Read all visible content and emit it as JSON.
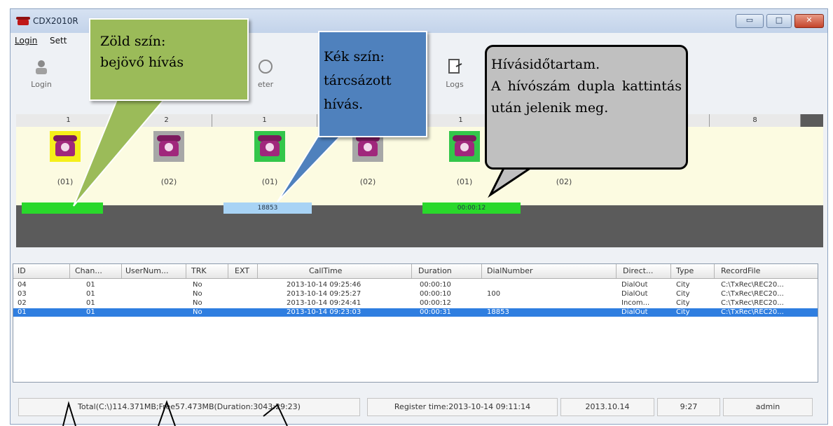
{
  "window": {
    "title": "CDX2010R",
    "controls": {
      "minimize": "▭",
      "maximize": "□",
      "close": "✕"
    }
  },
  "menu": [
    "Login",
    "Sett"
  ],
  "toolbar": {
    "buttons": [
      "Login",
      "eter",
      "Logs"
    ]
  },
  "channels": {
    "headers": [
      "1",
      "2",
      "1",
      "",
      "1",
      "",
      "",
      "",
      "8"
    ],
    "phones": [
      {
        "ext": "(01)",
        "bg_color": "#f5ef1a",
        "state": "incoming"
      },
      {
        "ext": "(02)",
        "bg_color": "#a7a7a7",
        "state": "idle"
      },
      {
        "ext": "(01)",
        "bg_color": "#33c64a",
        "state": "offhook"
      },
      {
        "ext": "(02)",
        "bg_color": "#a7a7a7",
        "state": "idle"
      },
      {
        "ext": "(01)",
        "bg_color": "#33c64a",
        "state": "offhook"
      },
      {
        "ext": "(02)",
        "bg_color": "#a7a7a7",
        "state": "idle"
      }
    ],
    "status_bars": [
      {
        "text": "",
        "color": "#29d82b"
      },
      {
        "text": "18853",
        "color": "#a8d3f5"
      },
      {
        "text": "00:00:12",
        "color": "#29d82b"
      }
    ]
  },
  "table": {
    "columns": [
      "ID",
      "Chan...",
      "UserNum...",
      "TRK",
      "EXT",
      "CallTime",
      "Duration",
      "DialNumber",
      "Direct...",
      "Type",
      "RecordFile"
    ],
    "rows": [
      {
        "id": "04",
        "chan": "01",
        "usernum": "",
        "trk": "No",
        "ext": "",
        "calltime": "2013-10-14 09:25:46",
        "duration": "00:00:10",
        "dial": "",
        "direct": "DialOut",
        "type": "City",
        "file": "C:\\TxRec\\REC20..."
      },
      {
        "id": "03",
        "chan": "01",
        "usernum": "",
        "trk": "No",
        "ext": "",
        "calltime": "2013-10-14 09:25:27",
        "duration": "00:00:10",
        "dial": "100",
        "direct": "DialOut",
        "type": "City",
        "file": "C:\\TxRec\\REC20..."
      },
      {
        "id": "02",
        "chan": "01",
        "usernum": "",
        "trk": "No",
        "ext": "",
        "calltime": "2013-10-14 09:24:41",
        "duration": "00:00:12",
        "dial": "",
        "direct": "Incom...",
        "type": "City",
        "file": "C:\\TxRec\\REC20..."
      },
      {
        "id": "01",
        "chan": "01",
        "usernum": "",
        "trk": "No",
        "ext": "",
        "calltime": "2013-10-14 09:23:03",
        "duration": "00:00:31",
        "dial": "18853",
        "direct": "DialOut",
        "type": "City",
        "file": "C:\\TxRec\\REC20..."
      }
    ]
  },
  "statusbar": {
    "disk": "Total(C:\\)114.371MB;Free57.473MB(Duration:3043:29:23)",
    "register": "Register time:2013-10-14 09:11:14",
    "date": "2013.10.14",
    "time": "9:27",
    "user": "admin"
  },
  "callouts": {
    "green": [
      "Zöld szín:",
      "bejövő hívás"
    ],
    "blue": [
      "Kék szín:",
      "tárcsázott",
      "hívás."
    ],
    "gray": [
      "Hívásidőtartam.",
      "A hívószám dupla kattintás után jelenik meg."
    ]
  },
  "colors": {
    "green_callout": "#9bbb59",
    "blue_callout": "#4f81bd",
    "gray_callout": "#c0c0c0",
    "selection": "#2f7ee0"
  }
}
